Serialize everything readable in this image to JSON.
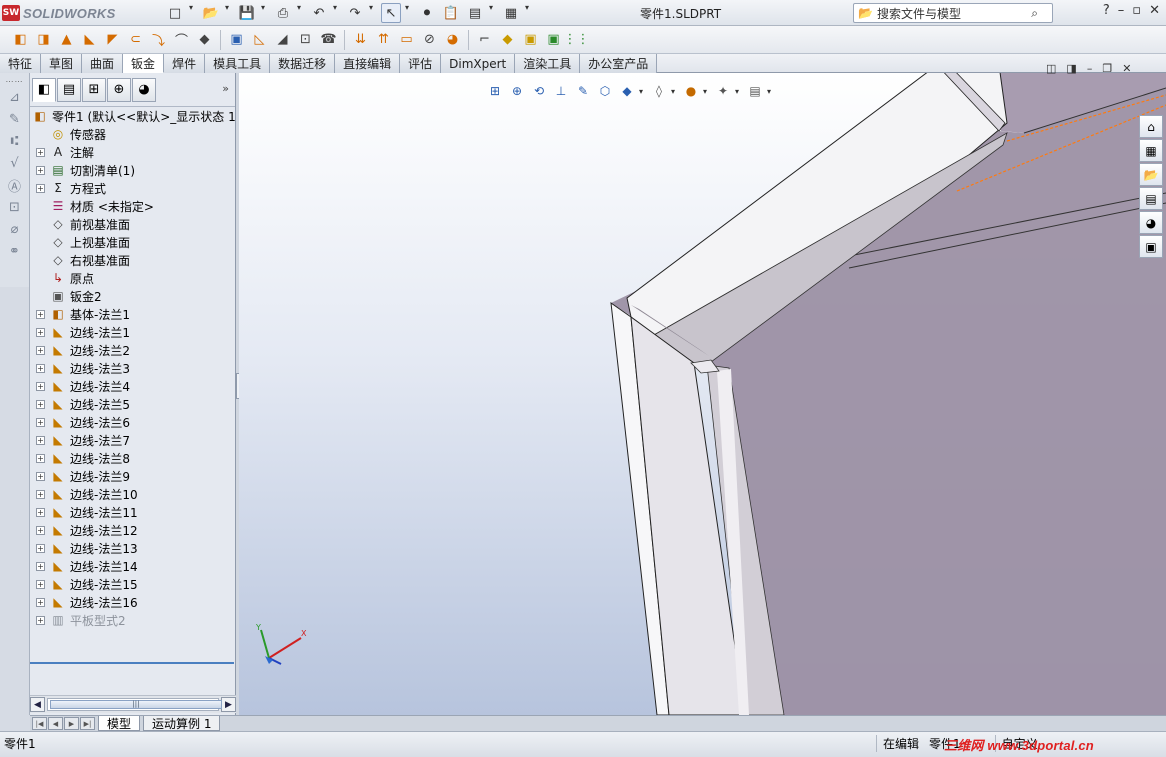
{
  "app": {
    "logo_badge": "SW",
    "logo_text": "SOLIDWORKS",
    "document_title": "零件1.SLDPRT",
    "search_placeholder": "搜索文件与模型",
    "help_label": "?"
  },
  "quick_access": [
    {
      "name": "new-icon",
      "glyph": "□"
    },
    {
      "name": "open-icon",
      "glyph": "📂"
    },
    {
      "name": "save-icon",
      "glyph": "💾"
    },
    {
      "name": "print-icon",
      "glyph": "⎙"
    },
    {
      "name": "undo-icon",
      "glyph": "↶"
    },
    {
      "name": "redo-icon",
      "glyph": "↷"
    },
    {
      "name": "select-icon",
      "glyph": "↖"
    },
    {
      "name": "rebuild-icon",
      "glyph": "⚫"
    },
    {
      "name": "file-properties-icon",
      "glyph": "📋"
    },
    {
      "name": "options-icon",
      "glyph": "▤"
    },
    {
      "name": "view-layout-icon",
      "glyph": "▦"
    }
  ],
  "command_icons": [
    {
      "name": "base-flange-icon",
      "glyph": "◧",
      "c": "o"
    },
    {
      "name": "convert-to-sheet-metal-icon",
      "glyph": "◨",
      "c": "o"
    },
    {
      "name": "lofted-bend-icon",
      "glyph": "▲",
      "c": "o"
    },
    {
      "name": "edge-flange-icon",
      "glyph": "◣",
      "c": "o"
    },
    {
      "name": "miter-flange-icon",
      "glyph": "◤",
      "c": "o"
    },
    {
      "name": "hem-icon",
      "glyph": "⊂",
      "c": "o"
    },
    {
      "name": "jog-icon",
      "glyph": "⤵",
      "c": "o"
    },
    {
      "name": "sketched-bend-icon",
      "glyph": "⌒",
      "c": "k"
    },
    {
      "name": "cross-break-icon",
      "glyph": "◆",
      "c": "k"
    },
    {
      "name": "closed-corner-icon",
      "glyph": "▣",
      "c": "b"
    },
    {
      "name": "welded-corner-icon",
      "glyph": "◺",
      "c": "o"
    },
    {
      "name": "break-corner-icon",
      "glyph": "◢",
      "c": "k"
    },
    {
      "name": "simple-hole-icon",
      "glyph": "⊡",
      "c": "k"
    },
    {
      "name": "vent-icon",
      "glyph": "☎",
      "c": "k"
    },
    {
      "name": "unfold-icon",
      "glyph": "⇊",
      "c": "o"
    },
    {
      "name": "fold-icon",
      "glyph": "⇈",
      "c": "o"
    },
    {
      "name": "flatten-icon",
      "glyph": "▭",
      "c": "o"
    },
    {
      "name": "no-bends-icon",
      "glyph": "⊘",
      "c": "k"
    },
    {
      "name": "rip-icon",
      "glyph": "◕",
      "c": "o"
    },
    {
      "name": "insert-bends-icon",
      "glyph": "⌐",
      "c": "k"
    },
    {
      "name": "extruded-cut-icon",
      "glyph": "◆",
      "c": "y"
    },
    {
      "name": "forming-tool-icon",
      "glyph": "▣",
      "c": "y"
    },
    {
      "name": "sheet-metal-gusset-icon",
      "glyph": "▣",
      "c": "g"
    },
    {
      "name": "linear-pattern-icon",
      "glyph": "⋮⋮",
      "c": "g"
    }
  ],
  "tabs": [
    "特征",
    "草图",
    "曲面",
    "钣金",
    "焊件",
    "模具工具",
    "数据迁移",
    "直接编辑",
    "评估",
    "DimXpert",
    "渲染工具",
    "办公室产品"
  ],
  "active_tab": "钣金",
  "feature_tree": {
    "root_label": "零件1  (默认<<默认>_显示状态 1",
    "nodes": [
      {
        "label": "传感器",
        "icon": "sensor-icon",
        "cls": "ic-sensor",
        "glyph": "◎",
        "expandable": false
      },
      {
        "label": "注解",
        "icon": "annotations-icon",
        "cls": "ic-note",
        "glyph": "A",
        "expandable": true
      },
      {
        "label": "切割清单(1)",
        "icon": "cut-list-icon",
        "cls": "ic-cut",
        "glyph": "▤",
        "expandable": true
      },
      {
        "label": "方程式",
        "icon": "equations-icon",
        "cls": "ic-eq",
        "glyph": "Σ",
        "expandable": true
      },
      {
        "label": "材质 <未指定>",
        "icon": "material-icon",
        "cls": "ic-mat",
        "glyph": "☰",
        "expandable": false
      },
      {
        "label": "前视基准面",
        "icon": "plane-icon",
        "cls": "ic-plane",
        "glyph": "◇",
        "expandable": false
      },
      {
        "label": "上视基准面",
        "icon": "plane-icon",
        "cls": "ic-plane",
        "glyph": "◇",
        "expandable": false
      },
      {
        "label": "右视基准面",
        "icon": "plane-icon",
        "cls": "ic-plane",
        "glyph": "◇",
        "expandable": false
      },
      {
        "label": "原点",
        "icon": "origin-icon",
        "cls": "ic-origin",
        "glyph": "↳",
        "expandable": false
      },
      {
        "label": "钣金2",
        "icon": "sheet-metal-icon",
        "cls": "ic-sm",
        "glyph": "▣",
        "expandable": false
      },
      {
        "label": "基体-法兰1",
        "icon": "base-flange-icon",
        "cls": "ic-base",
        "glyph": "◧",
        "expandable": true
      },
      {
        "label": "边线-法兰1",
        "icon": "edge-flange-icon",
        "cls": "ic-flange",
        "glyph": "◣",
        "expandable": true
      },
      {
        "label": "边线-法兰2",
        "icon": "edge-flange-icon",
        "cls": "ic-flange",
        "glyph": "◣",
        "expandable": true
      },
      {
        "label": "边线-法兰3",
        "icon": "edge-flange-icon",
        "cls": "ic-flange",
        "glyph": "◣",
        "expandable": true
      },
      {
        "label": "边线-法兰4",
        "icon": "edge-flange-icon",
        "cls": "ic-flange",
        "glyph": "◣",
        "expandable": true
      },
      {
        "label": "边线-法兰5",
        "icon": "edge-flange-icon",
        "cls": "ic-flange",
        "glyph": "◣",
        "expandable": true
      },
      {
        "label": "边线-法兰6",
        "icon": "edge-flange-icon",
        "cls": "ic-flange",
        "glyph": "◣",
        "expandable": true
      },
      {
        "label": "边线-法兰7",
        "icon": "edge-flange-icon",
        "cls": "ic-flange",
        "glyph": "◣",
        "expandable": true
      },
      {
        "label": "边线-法兰8",
        "icon": "edge-flange-icon",
        "cls": "ic-flange",
        "glyph": "◣",
        "expandable": true
      },
      {
        "label": "边线-法兰9",
        "icon": "edge-flange-icon",
        "cls": "ic-flange",
        "glyph": "◣",
        "expandable": true
      },
      {
        "label": "边线-法兰10",
        "icon": "edge-flange-icon",
        "cls": "ic-flange",
        "glyph": "◣",
        "expandable": true
      },
      {
        "label": "边线-法兰11",
        "icon": "edge-flange-icon",
        "cls": "ic-flange",
        "glyph": "◣",
        "expandable": true
      },
      {
        "label": "边线-法兰12",
        "icon": "edge-flange-icon",
        "cls": "ic-flange",
        "glyph": "◣",
        "expandable": true
      },
      {
        "label": "边线-法兰13",
        "icon": "edge-flange-icon",
        "cls": "ic-flange",
        "glyph": "◣",
        "expandable": true
      },
      {
        "label": "边线-法兰14",
        "icon": "edge-flange-icon",
        "cls": "ic-flange",
        "glyph": "◣",
        "expandable": true
      },
      {
        "label": "边线-法兰15",
        "icon": "edge-flange-icon",
        "cls": "ic-flange",
        "glyph": "◣",
        "expandable": true
      },
      {
        "label": "边线-法兰16",
        "icon": "edge-flange-icon",
        "cls": "ic-flange",
        "glyph": "◣",
        "expandable": true
      },
      {
        "label": "平板型式2",
        "icon": "flat-pattern-icon",
        "cls": "ic-flat",
        "glyph": "▥",
        "expandable": true,
        "suppressed": true
      }
    ]
  },
  "panel_tabs": [
    {
      "name": "feature-manager-tab",
      "glyph": "◧"
    },
    {
      "name": "property-manager-tab",
      "glyph": "▤"
    },
    {
      "name": "configuration-manager-tab",
      "glyph": "⊞"
    },
    {
      "name": "dimxpert-manager-tab",
      "glyph": "⊕"
    },
    {
      "name": "display-manager-tab",
      "glyph": "◕"
    }
  ],
  "left_icons": [
    "smart-dimension-icon",
    "note-icon",
    "balloon-icon",
    "surface-finish-icon",
    "datum-icon",
    "geometric-tolerance-icon",
    "hole-callout-icon",
    "mate-icon"
  ],
  "view_tools": [
    {
      "name": "zoom-to-fit-icon",
      "glyph": "⊞",
      "c": ""
    },
    {
      "name": "zoom-to-area-icon",
      "glyph": "⊕",
      "c": ""
    },
    {
      "name": "previous-view-icon",
      "glyph": "⟲",
      "c": ""
    },
    {
      "name": "section-view-icon",
      "glyph": "⊥",
      "c": ""
    },
    {
      "name": "dynamic-annotation-icon",
      "glyph": "✎",
      "c": ""
    },
    {
      "name": "view-orientation-icon",
      "glyph": "⬡",
      "c": ""
    },
    {
      "name": "display-style-icon",
      "glyph": "◆",
      "c": ""
    },
    {
      "name": "hide-show-icon",
      "glyph": "◊",
      "c": "g"
    },
    {
      "name": "edit-appearance-icon",
      "glyph": "●",
      "c": "o"
    },
    {
      "name": "apply-scene-icon",
      "glyph": "✦",
      "c": "g"
    },
    {
      "name": "view-settings-icon",
      "glyph": "▤",
      "c": "g"
    }
  ],
  "task_pane": [
    {
      "name": "solidworks-resources-icon",
      "glyph": "⌂"
    },
    {
      "name": "design-library-icon",
      "glyph": "▦"
    },
    {
      "name": "file-explorer-icon",
      "glyph": "📂"
    },
    {
      "name": "view-palette-icon",
      "glyph": "▤"
    },
    {
      "name": "appearances-icon",
      "glyph": "◕"
    },
    {
      "name": "custom-properties-icon",
      "glyph": "▣"
    }
  ],
  "bottom_tabs": [
    "模型",
    "运动算例 1"
  ],
  "status": {
    "left": "零件1",
    "editing": "在编辑",
    "editing_target": "零件1",
    "custom": "自定义"
  },
  "watermark": "三维网 www.3dportal.cn"
}
